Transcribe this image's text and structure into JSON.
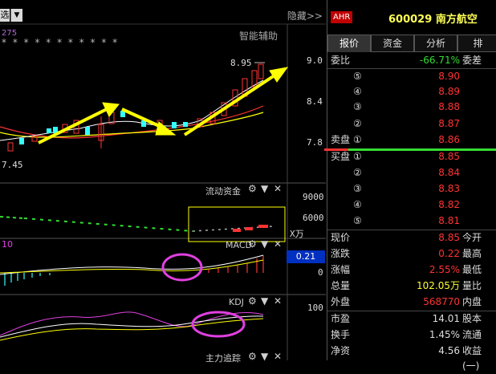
{
  "toolbar": {
    "select_label": "选",
    "hide_label": "隐藏>>"
  },
  "chart": {
    "fund_code": "275",
    "stars": "* * *   * * * *   * * * *",
    "assist_label": "智能辅助",
    "high_label": "8.95",
    "low_label": "7.45",
    "price_axis": [
      "9.0",
      "8.4",
      "7.8"
    ],
    "flow_title": "流动资金",
    "flow_axis": [
      "9000",
      "6000"
    ],
    "flow_unit": "X万",
    "macd_title": "MACD",
    "macd_value": "0.21",
    "macd_axis_zero": "0",
    "macd_left_label": "10",
    "kdj_title": "KDJ",
    "kdj_axis_top": "100",
    "next_panel_title": "主力追踪"
  },
  "quote": {
    "exchange_badge": "AHR",
    "code": "600029",
    "name": "南方航空",
    "tabs": [
      "报价",
      "资金",
      "分析",
      "排"
    ],
    "weibi_label": "委比",
    "weibi_value": "-66.71%",
    "weicha_label": "委差",
    "sell_label": "卖盘",
    "buy_label": "买盘",
    "sell": [
      {
        "idx": "⑤",
        "price": "8.90"
      },
      {
        "idx": "④",
        "price": "8.89"
      },
      {
        "idx": "③",
        "price": "8.88"
      },
      {
        "idx": "②",
        "price": "8.87"
      },
      {
        "idx": "①",
        "price": "8.86"
      }
    ],
    "buy": [
      {
        "idx": "①",
        "price": "8.85"
      },
      {
        "idx": "②",
        "price": "8.84"
      },
      {
        "idx": "③",
        "price": "8.83"
      },
      {
        "idx": "④",
        "price": "8.82"
      },
      {
        "idx": "⑤",
        "price": "8.81"
      }
    ],
    "stats": [
      {
        "label": "现价",
        "value": "8.85",
        "right": "今开",
        "color": "red"
      },
      {
        "label": "涨跌",
        "value": "0.22",
        "right": "最高",
        "color": "red"
      },
      {
        "label": "涨幅",
        "value": "2.55%",
        "right": "最低",
        "color": "red"
      },
      {
        "label": "总量",
        "value": "102.05万",
        "right": "量比",
        "color": "yellow"
      },
      {
        "label": "外盘",
        "value": "568770",
        "right": "内盘",
        "color": "red"
      },
      {
        "label": "市盈",
        "value": "14.01",
        "right": "股本",
        "color": "white"
      },
      {
        "label": "换手",
        "value": "1.45%",
        "right": "流通",
        "color": "white"
      },
      {
        "label": "净资",
        "value": "4.56",
        "right": "收益(一)",
        "color": "white"
      }
    ]
  },
  "colors": {
    "up": "#ff3333",
    "down": "#33ffff",
    "arrow": "#ffff00",
    "highlight": "#e040e0",
    "ma_white": "#ffffff",
    "ma_yellow": "#ffff00",
    "ma_red": "#ff3333"
  }
}
